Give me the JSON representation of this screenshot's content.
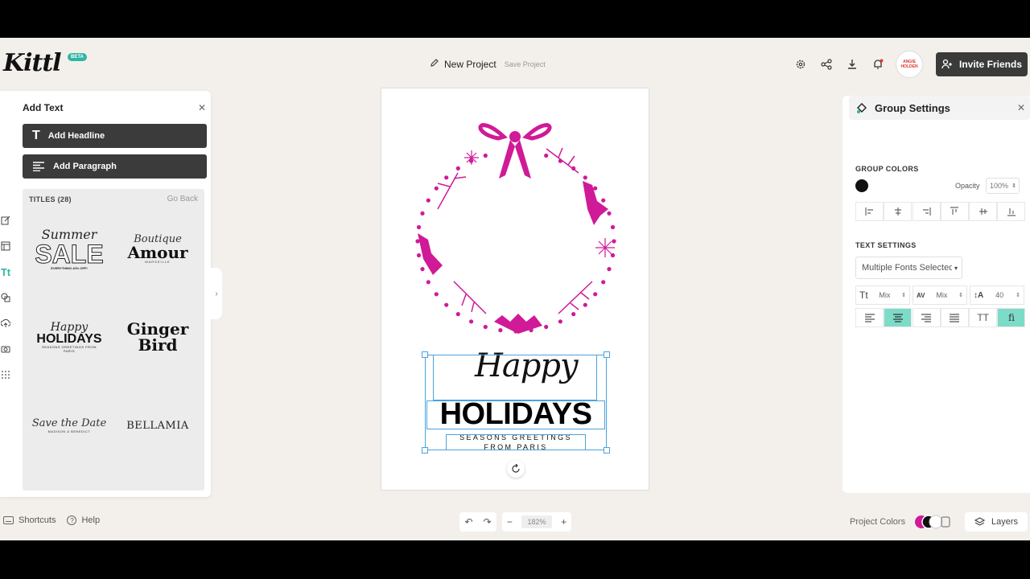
{
  "app": {
    "logo": "Kittl",
    "badge": "BETA"
  },
  "project": {
    "name": "New Project",
    "save_label": "Save Project"
  },
  "header": {
    "avatar_text": "ANGIE HOLDEN",
    "invite_label": "Invite Friends"
  },
  "add_text": {
    "title": "Add Text",
    "headline_label": "Add Headline",
    "paragraph_label": "Add Paragraph",
    "section_label": "TITLES (28)",
    "go_back": "Go Back",
    "tiles": [
      {
        "line1": "Summer",
        "line2": "SALE",
        "line3": "EVERYTHING 40% OFF!"
      },
      {
        "line1": "Boutique",
        "line2": "Amour",
        "line3": "MARSEILLE"
      },
      {
        "line1": "Happy",
        "line2": "HOLIDAYS",
        "line3": "SEASONS GREETINGS FROM PARIS"
      },
      {
        "line1": "Ginger",
        "line2": "Bird"
      },
      {
        "line1": "Save the Date",
        "line2": "MADISON & BENEDICT"
      },
      {
        "line1": "BELLAMIA"
      }
    ]
  },
  "canvas": {
    "script_text": "Happy",
    "headline_text": "HOLIDAYS",
    "sub_line1": "SEASONS GREETINGS",
    "sub_line2": "FROM PARIS",
    "wreath_color": "#d01a98"
  },
  "group_settings": {
    "title": "Group Settings",
    "group_colors_label": "GROUP COLORS",
    "opacity_label": "Opacity",
    "opacity_value": "100%",
    "text_settings_label": "TEXT SETTINGS",
    "font_select": "Multiple Fonts Selected",
    "size_value": "Mix",
    "spacing_value": "Mix",
    "line_height_value": "40",
    "transform_label": "TT"
  },
  "bottom": {
    "shortcuts": "Shortcuts",
    "help": "Help",
    "zoom": "182%",
    "project_colors": "Project Colors",
    "layers": "Layers"
  },
  "colors": {
    "accent": "#7ddcc8",
    "wreath": "#d01a98",
    "dark_button": "#3a3a3a"
  }
}
